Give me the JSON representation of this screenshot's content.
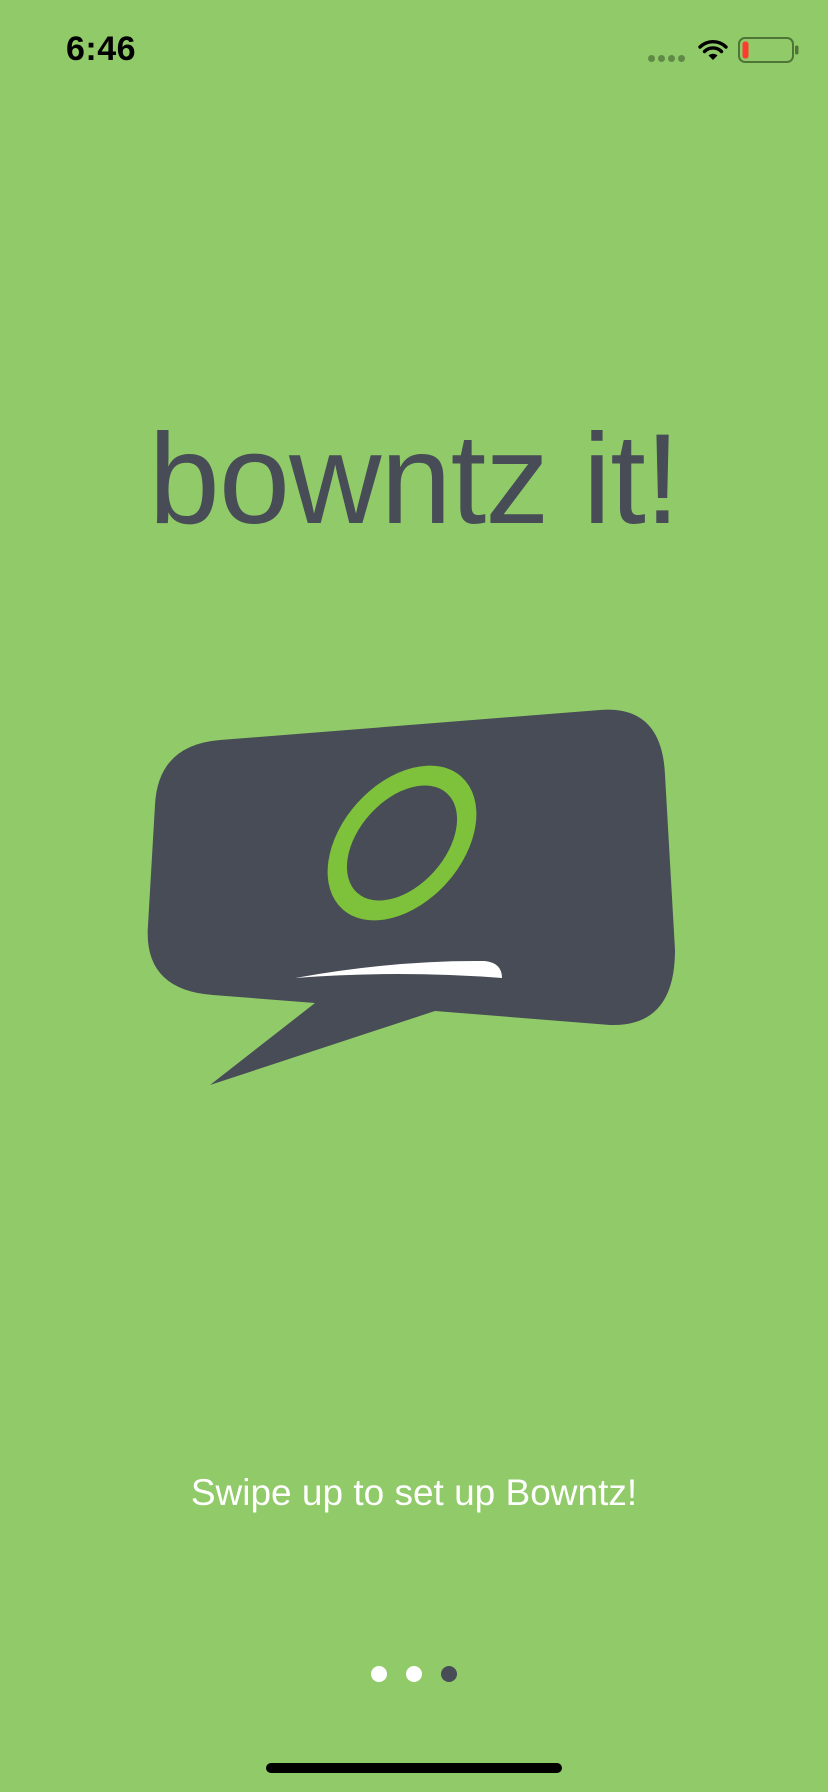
{
  "status_bar": {
    "time": "6:46",
    "signal_icon": "cellular-signal-icon",
    "wifi_icon": "wifi-icon",
    "battery_icon": "battery-low-icon",
    "battery_level": 0.1
  },
  "onboarding": {
    "headline": "bowntz it!",
    "logo_icon": "speech-bubble-logo",
    "instruction": "Swipe up to set up Bowntz!",
    "page_indicator": {
      "total": 3,
      "current": 3
    }
  },
  "colors": {
    "background": "#91cb69",
    "text_dark": "#474c56",
    "text_light": "#ffffff",
    "accent_green": "#7ec23b",
    "bubble": "#474c56",
    "battery_red": "#ff3b30"
  }
}
